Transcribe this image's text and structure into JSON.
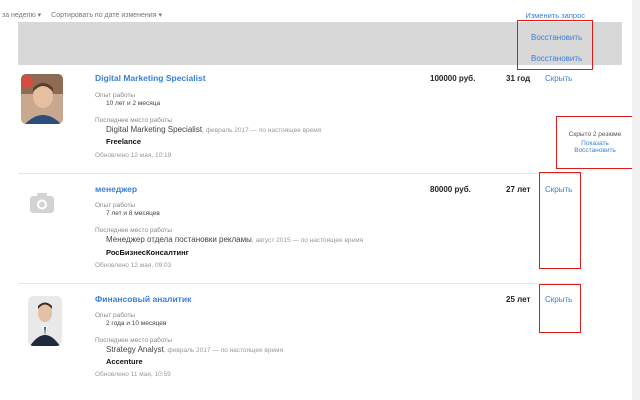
{
  "toolbar": {
    "period": "за неделю",
    "sort": "Сортировать по дате изменения",
    "change_query": "Изменить запрос"
  },
  "hidden_block": {
    "restore_1": "Восстановить",
    "restore_2": "Восстановить"
  },
  "side_panel": {
    "text": "Скрыто 2 резюме",
    "show": "Показать",
    "restore": "Восстановить"
  },
  "labels": {
    "experience": "Опыт работы",
    "last_job": "Последнее место работы",
    "hide": "Скрыть"
  },
  "resumes": [
    {
      "title": "Digital Marketing Specialist",
      "salary": "100000 руб.",
      "age": "31 год",
      "experience": "10 лет и 2 месяца",
      "job_title": "Digital Marketing Specialist",
      "job_period": ", февраль 2017 — по настоящее время",
      "company": "Freelance",
      "updated": "Обновлено 12 мая, 10:19",
      "photo": "photo-man-beard"
    },
    {
      "title": "менеджер",
      "salary": "80000 руб.",
      "age": "27 лет",
      "experience": "7 лет и 8 месяцев",
      "job_title": "Менеджер отдела постановки рекламы",
      "job_period": ", август 2015 — по настоящее время",
      "company": "РосБизнесКонсалтинг",
      "updated": "Обновлено 12 мая, 09:03",
      "photo": "camera-placeholder-icon"
    },
    {
      "title": "Финансовый аналитик",
      "salary": "",
      "age": "25 лет",
      "experience": "2 года и 10 месяцев",
      "job_title": "Strategy Analyst",
      "job_period": ", февраль 2017 — по настоящее время",
      "company": "Accenture",
      "updated": "Обновлено 11 мая, 10:59",
      "photo": "photo-man-suit"
    }
  ],
  "colors": {
    "link": "#3b7fd4",
    "highlight_box": "#e01919",
    "hidden_band": "#d8d8d8"
  }
}
